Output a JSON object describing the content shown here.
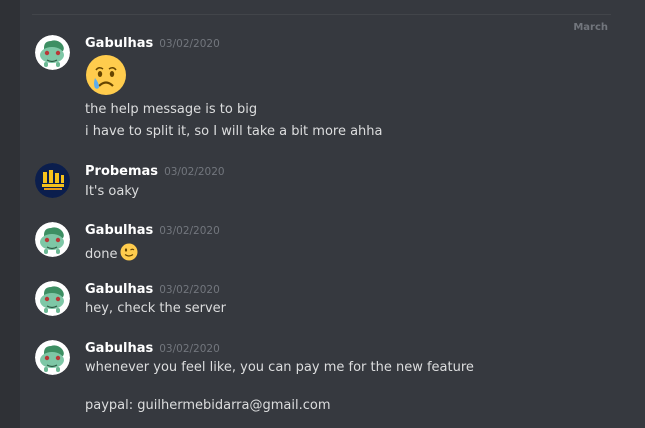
{
  "divider": {
    "label": "March"
  },
  "messages": [
    {
      "author": "Gabulhas",
      "timestamp": "03/02/2020",
      "avatar": "bulbasaur-avatar",
      "emoji": "crying-face",
      "lines": [
        "the help message is to big",
        "i have to split it, so I will take a bit more ahha"
      ]
    },
    {
      "author": "Probemas",
      "timestamp": "03/02/2020",
      "avatar": "probemas-logo",
      "lines": [
        "It's oaky"
      ]
    },
    {
      "author": "Gabulhas",
      "timestamp": "03/02/2020",
      "avatar": "bulbasaur-avatar",
      "lines": [
        "done"
      ],
      "inline_emoji": "winking-face"
    },
    {
      "author": "Gabulhas",
      "timestamp": "03/02/2020",
      "avatar": "bulbasaur-avatar",
      "lines": [
        "hey, check the server"
      ]
    },
    {
      "author": "Gabulhas",
      "timestamp": "03/02/2020",
      "avatar": "bulbasaur-avatar",
      "lines": [
        "whenever you feel like, you can pay me for the new feature",
        "paypal: guilhermebidarra@gmail.com"
      ]
    }
  ],
  "colors": {
    "background": "#36393f",
    "author": "#ffffff",
    "timestamp": "#72767d",
    "text": "#dcddde",
    "divider": "#42454a"
  }
}
